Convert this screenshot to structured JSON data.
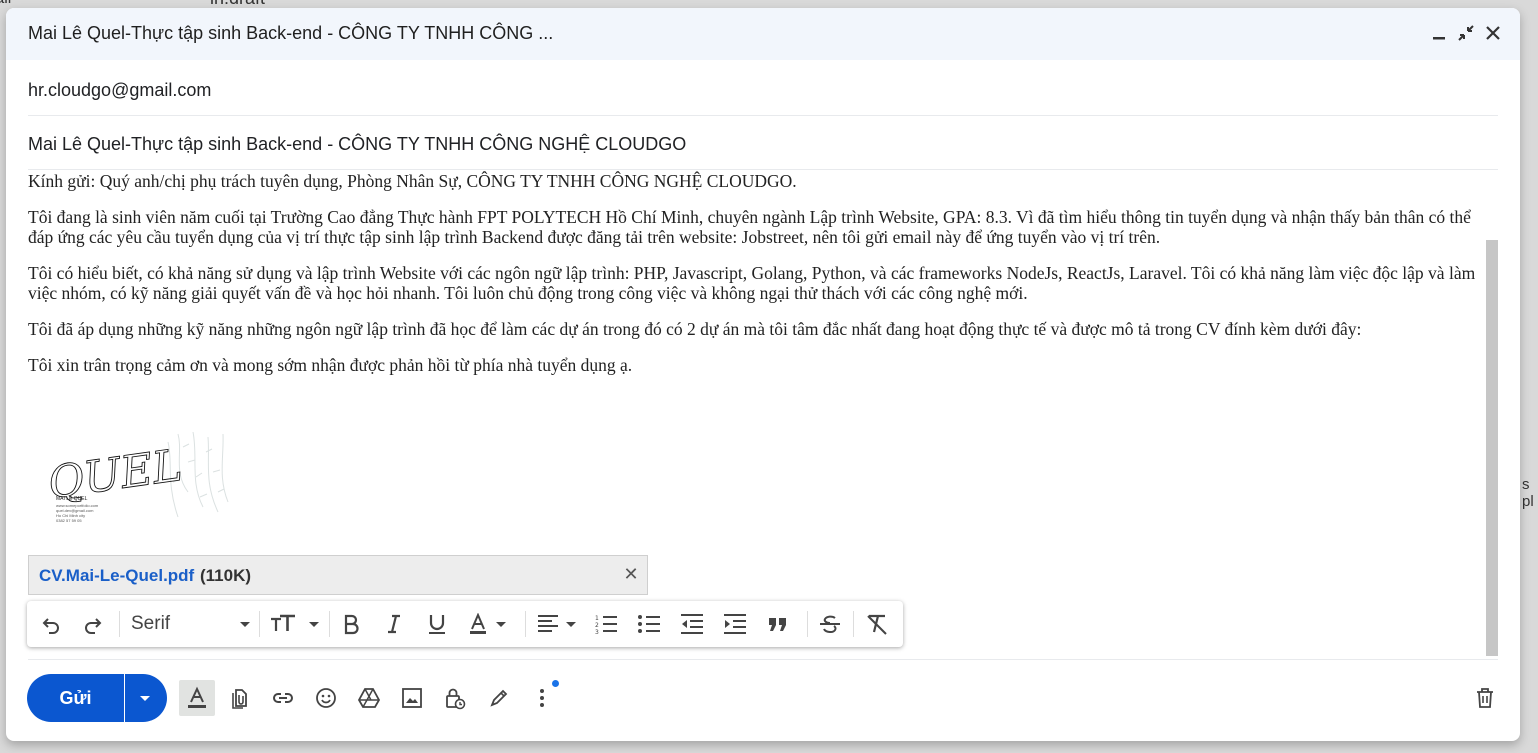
{
  "window": {
    "title": "Mai Lê Quel-Thực tập sinh Back-end - CÔNG TY TNHH CÔNG ..."
  },
  "background": {
    "search_fragment": "in:draft",
    "left_fragment": "...ail",
    "right_fragment": "s pl"
  },
  "fields": {
    "to": "hr.cloudgo@gmail.com",
    "subject": "Mai Lê Quel-Thực tập sinh Back-end - CÔNG TY TNHH CÔNG NGHỆ CLOUDGO"
  },
  "body": {
    "greeting": "Kính gửi: Quý anh/chị phụ trách tuyên dụng, Phòng Nhân Sự, CÔNG TY TNHH CÔNG NGHỆ CLOUDGO.",
    "p1": "Tôi đang là sinh viên năm cuối tại Trường Cao đẳng Thực hành FPT POLYTECH Hồ Chí Minh, chuyên ngành Lập trình Website, GPA: 8.3. Vì đã tìm hiểu thông tin tuyển dụng và nhận thấy bản thân có thể đáp ứng các yêu cầu tuyển dụng của vị trí thực tập sinh lập trình Backend được đăng tải trên website: Jobstreet, nên tôi gửi email này để ứng tuyển vào vị trí trên.",
    "p2": "Tôi có hiểu biết, có khả năng sử dụng và lập trình Website với các ngôn ngữ lập trình: PHP, Javascript, Golang, Python,  và các frameworks NodeJs, ReactJs, Laravel. Tôi có khả năng làm việc độc lập và làm việc nhóm, có kỹ năng giải quyết vấn đề và học hỏi nhanh. Tôi luôn chủ động trong công việc và không ngại thử thách với các công nghệ mới.",
    "p3": "Tôi đã áp dụng những kỹ năng những ngôn ngữ lập trình đã học để làm các dự án trong đó có 2 dự án mà tôi tâm đắc nhất đang hoạt động thực tế và được mô tả trong CV đính kèm dưới đây:",
    "closing": "Tôi xin trân trọng cảm ơn và mong sớm nhận được phản hồi từ phía nhà tuyển dụng ạ."
  },
  "signature": {
    "mark": "QUEL",
    "name": "MAI LÊ QUEL",
    "line1": "www.someportfolio.com",
    "line2": "quel.dev@gmail.com",
    "line3": "Ho Chi Minh city",
    "line4": "0382 57 59 05"
  },
  "attachment": {
    "filename": "CV.Mai-Le-Quel.pdf",
    "size": "(110K)"
  },
  "formatting": {
    "font": "Serif"
  },
  "actions": {
    "send_label": "Gửi"
  },
  "colors": {
    "send_button": "#0b57d0",
    "header_bg": "#f2f6fc",
    "attachment_link": "#1a5fc8"
  }
}
